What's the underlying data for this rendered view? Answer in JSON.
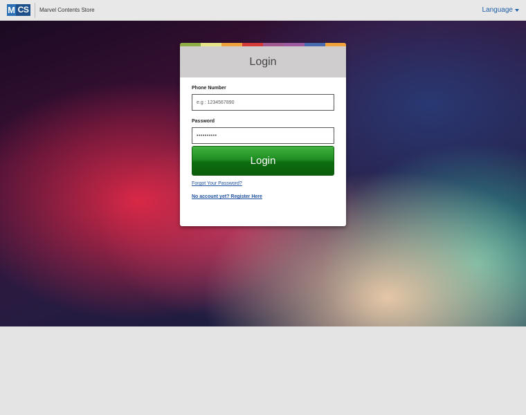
{
  "header": {
    "logo_m": "M",
    "logo_cs": "CS",
    "store_name": "Marvel Contents Store",
    "language_label": "Language"
  },
  "stripe_colors": [
    "#8fae45",
    "#e6e389",
    "#f0a23c",
    "#d43a37",
    "#a05a90",
    "#9c5aa0",
    "#4a6aaf",
    "#f2a23a"
  ],
  "login": {
    "title": "Login",
    "phone_label": "Phone Number",
    "phone_placeholder": "e.g : 1234567890",
    "password_label": "Password",
    "password_value": "••••••••••",
    "submit_label": "Login",
    "forgot_link": "Forgot Your Password?",
    "register_link": "No account yet? Register Here"
  }
}
